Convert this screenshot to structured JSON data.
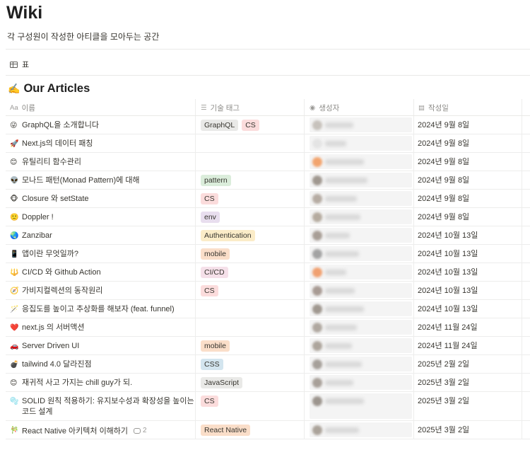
{
  "page": {
    "title": "Wiki",
    "description": "각 구성원이 작성한 아티클을 모아두는 공간"
  },
  "view": {
    "tab_label": "표",
    "tab_icon": "table-icon"
  },
  "database": {
    "title": "Our Articles",
    "title_icon": "✍️",
    "columns": [
      {
        "label": "이름",
        "icon": "Aa"
      },
      {
        "label": "기술 태그",
        "icon": "☰"
      },
      {
        "label": "생성자",
        "icon": "◉"
      },
      {
        "label": "작성일",
        "icon": "▤"
      }
    ],
    "rows": [
      {
        "emoji": "😜",
        "title": "GraphQL을 소개합니다",
        "tags": [
          {
            "label": "GraphQL",
            "color": "#e9e9e7"
          },
          {
            "label": "CS",
            "color": "#fbdcdc"
          }
        ],
        "avatar": "#c7c2bc",
        "date": "2024년 9월 8일"
      },
      {
        "emoji": "🚀",
        "title": "Next.js의 데이터 패칭",
        "tags": [],
        "avatar": "#e4e4e4",
        "date": "2024년 9월 8일"
      },
      {
        "emoji": "😊",
        "title": "유틸리티 함수관리",
        "tags": [],
        "avatar": "#f2a46e",
        "date": "2024년 9월 8일"
      },
      {
        "emoji": "👽",
        "title": "모나드 패턴(Monad Pattern)에 대해",
        "tags": [
          {
            "label": "pattern",
            "color": "#dbeddb"
          }
        ],
        "avatar": "#a09890",
        "date": "2024년 9월 8일"
      },
      {
        "emoji": "🐵",
        "title": "Closure 와 setState",
        "tags": [
          {
            "label": "CS",
            "color": "#fbdcdc"
          }
        ],
        "avatar": "#b6aca3",
        "date": "2024년 9월 8일"
      },
      {
        "emoji": "🙂",
        "title": "Doppler !",
        "tags": [
          {
            "label": "env",
            "color": "#e8deee"
          }
        ],
        "avatar": "#b5ab9f",
        "date": "2024년 9월 8일"
      },
      {
        "emoji": "🌏",
        "title": "Zanzibar",
        "tags": [
          {
            "label": "Authentication",
            "color": "#fbecc8"
          }
        ],
        "avatar": "#a89e96",
        "date": "2024년 10월 13일"
      },
      {
        "emoji": "📱",
        "title": "앱이란 무엇일까?",
        "tags": [
          {
            "label": "mobile",
            "color": "#fadec9"
          }
        ],
        "avatar": "#a3a3a3",
        "date": "2024년 10월 13일"
      },
      {
        "emoji": "🔱",
        "title": "CI/CD 와 Github Action",
        "tags": [
          {
            "label": "CI/CD",
            "color": "#f5e0e9"
          }
        ],
        "avatar": "#f0a070",
        "date": "2024년 10월 13일"
      },
      {
        "emoji": "🧭",
        "title": "가비지컬렉션의 동작원리",
        "tags": [
          {
            "label": "CS",
            "color": "#fbdcdc"
          }
        ],
        "avatar": "#a89b94",
        "date": "2024년 10월 13일"
      },
      {
        "emoji": "🪄",
        "title": "응집도를 높이고 추상화를 해보자 (feat. funnel)",
        "tags": [],
        "avatar": "#a09890",
        "date": "2024년 10월 13일"
      },
      {
        "emoji": "❤️",
        "title": "next.js 의 서버액션",
        "tags": [],
        "avatar": "#b0a8a0",
        "date": "2024년 11월 24일"
      },
      {
        "emoji": "🚗",
        "title": "Server Driven UI",
        "tags": [
          {
            "label": "mobile",
            "color": "#fadec9"
          }
        ],
        "avatar": "#ada59c",
        "date": "2024년 11월 24일"
      },
      {
        "emoji": "💣",
        "title": "tailwind 4.0 달라진점",
        "tags": [
          {
            "label": "CSS",
            "color": "#d3e5ef"
          }
        ],
        "avatar": "#a6a09a",
        "date": "2025년 2월 2일"
      },
      {
        "emoji": "😊",
        "title": "재귀적 사고 가지는 chill guy가 되.",
        "tags": [
          {
            "label": "JavaScript",
            "color": "#e9e9e7"
          }
        ],
        "avatar": "#a8a099",
        "date": "2025년 3월 2일"
      },
      {
        "emoji": "🫧",
        "title": "SOLID 원칙 적용하기: 유지보수성과 확장성을 높이는 코드 설계",
        "tags": [
          {
            "label": "CS",
            "color": "#fbdcdc"
          }
        ],
        "avatar": "#9c958e",
        "date": "2025년 3월 2일",
        "tall": true
      },
      {
        "emoji": "🎋",
        "title": "React Native 아키텍처 이해하기",
        "tags": [
          {
            "label": "React Native",
            "color": "#fadec9"
          }
        ],
        "avatar": "#aba39a",
        "date": "2025년 3월 2일",
        "comments": "2"
      }
    ]
  }
}
